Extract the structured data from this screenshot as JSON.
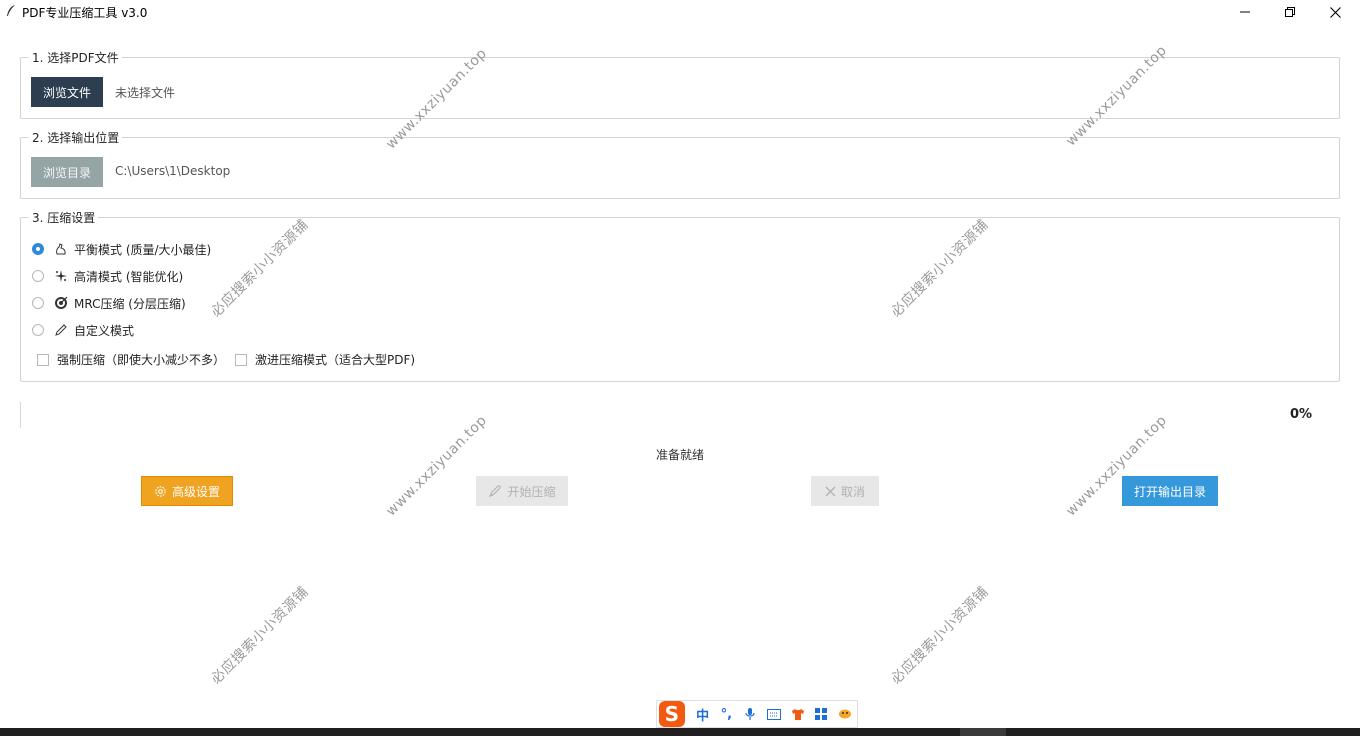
{
  "window": {
    "title": "PDF专业压缩工具 v3.0"
  },
  "section1": {
    "legend": "1. 选择PDF文件",
    "browse_label": "浏览文件",
    "file_status": "未选择文件"
  },
  "section2": {
    "legend": "2. 选择输出位置",
    "browse_label": "浏览目录",
    "output_path": "C:\\Users\\1\\Desktop"
  },
  "section3": {
    "legend": "3. 压缩设置",
    "modes": [
      {
        "label": "平衡模式 (质量/大小最佳)",
        "icon": "balance-icon",
        "selected": true
      },
      {
        "label": "高清模式 (智能优化)",
        "icon": "sparkle-icon",
        "selected": false
      },
      {
        "label": "MRC压缩 (分层压缩)",
        "icon": "target-icon",
        "selected": false
      },
      {
        "label": "自定义模式",
        "icon": "pencil-icon",
        "selected": false
      }
    ],
    "options": [
      {
        "label": "强制压缩（即使大小减少不多）",
        "checked": false
      },
      {
        "label": "激进压缩模式（适合大型PDF)",
        "checked": false
      }
    ]
  },
  "progress": {
    "value": 0,
    "percent_label": "0%",
    "status": "准备就绪"
  },
  "actions": {
    "advanced_label": "高级设置",
    "start_label": "开始压缩",
    "cancel_label": "取消",
    "open_output_label": "打开输出目录"
  },
  "watermarks": {
    "url": "www.xxziyuan.top",
    "cn": "必应搜索小小资源铺"
  },
  "ime": {
    "logo": "S",
    "lang": "中",
    "punct": "°,"
  },
  "colors": {
    "dark_button": "#2c3e50",
    "gray_button": "#95a5a6",
    "advanced_orange": "#f0a321",
    "open_output_blue": "#3498db",
    "radio_selected": "#2d8ad8",
    "ime_brand": "#f25a0f"
  }
}
